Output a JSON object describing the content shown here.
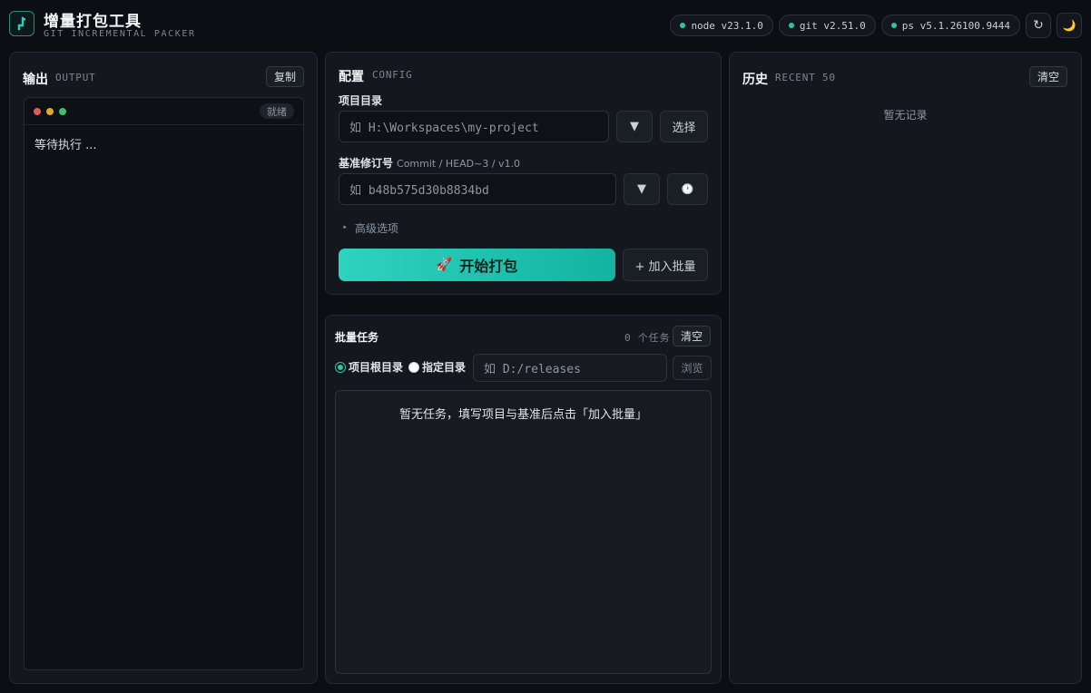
{
  "app": {
    "title": "增量打包工具",
    "subtitle": "GIT INCREMENTAL PACKER",
    "badges": [
      {
        "label": "node v23.1.0"
      },
      {
        "label": "git v2.51.0"
      },
      {
        "label": "ps v5.1.26100.9444"
      }
    ],
    "refresh_icon": "↻",
    "theme_icon": "🌙"
  },
  "output": {
    "title": "输出",
    "subtitle": "OUTPUT",
    "copy_label": "复制",
    "status": "就绪",
    "text": "等待执行 ..."
  },
  "config": {
    "title": "配置",
    "subtitle": "CONFIG",
    "project_dir_label": "项目目录",
    "project_dir_placeholder": "如 H:\\Workspaces\\my-project",
    "dropdown_icon": "▼",
    "select_label": "选择",
    "base_rev_label": "基准修订号",
    "base_rev_hint": "Commit / HEAD~3 / v1.0",
    "base_rev_placeholder": "如 b48b575d30b8834bd",
    "history_icon": "🕐",
    "advanced_label": "高级选项",
    "advanced_icon": "‣",
    "start_icon": "🚀",
    "start_label": "开始打包",
    "add_batch_label": "+ 加入批量"
  },
  "batch": {
    "title": "批量任务",
    "count_text": "0 个任务",
    "clear_label": "清空",
    "radio_root_label": "项目根目录",
    "radio_custom_label": "指定目录",
    "dir_placeholder": "如 D:/releases",
    "browse_label": "浏览",
    "empty_text": "暂无任务，填写项目与基准后点击「加入批量」"
  },
  "history": {
    "title": "历史",
    "subtitle": "RECENT 50",
    "clear_label": "清空",
    "empty_text": "暂无记录"
  },
  "colors": {
    "accent": "#2bc5a8",
    "background": "#0b0e12",
    "panel": "#14181e",
    "traffic_red": "#e05a57",
    "traffic_yellow": "#e0a82e",
    "traffic_green": "#3fbf6e"
  }
}
